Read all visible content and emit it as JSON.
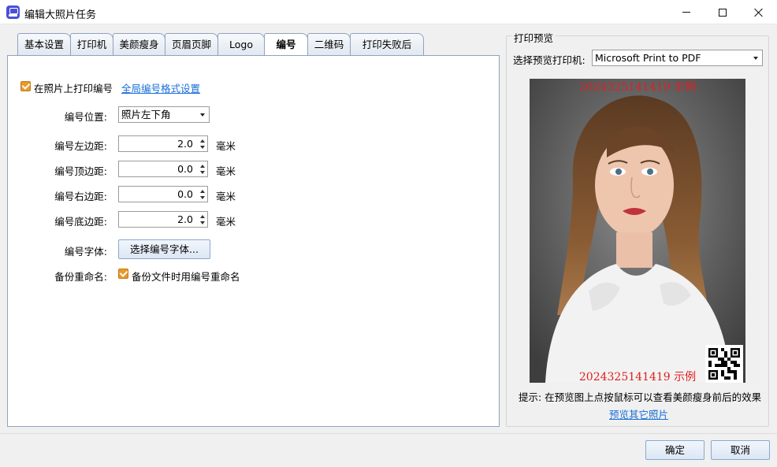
{
  "window": {
    "title": "编辑大照片任务"
  },
  "tabs": [
    {
      "label": "基本设置"
    },
    {
      "label": "打印机"
    },
    {
      "label": "美颜瘦身"
    },
    {
      "label": "页眉页脚"
    },
    {
      "label": "Logo"
    },
    {
      "label": "编号"
    },
    {
      "label": "二维码"
    },
    {
      "label": "打印失败后"
    }
  ],
  "active_tab": "编号",
  "numbering": {
    "print_number_label": "在照片上打印编号",
    "print_number_checked": true,
    "global_format_link": "全局编号格式设置",
    "position_label": "编号位置:",
    "position_value": "照片左下角",
    "left_margin_label": "编号左边距:",
    "left_margin_value": "2.0",
    "top_margin_label": "编号顶边距:",
    "top_margin_value": "0.0",
    "right_margin_label": "编号右边距:",
    "right_margin_value": "0.0",
    "bottom_margin_label": "编号底边距:",
    "bottom_margin_value": "2.0",
    "unit": "毫米",
    "font_label": "编号字体:",
    "font_button": "选择编号字体...",
    "backup_rename_label": "备份重命名:",
    "backup_rename_checkbox": "备份文件时用编号重命名",
    "backup_rename_checked": true
  },
  "preview": {
    "group_title": "打印预览",
    "printer_label": "选择预览打印机:",
    "printer_value": "Microsoft Print to PDF",
    "top_number": "2024325141419 示例",
    "bottom_number": "2024325141419 示例",
    "hint": "提示: 在预览图上点按鼠标可以查看美颜瘦身前后的效果",
    "other_photos_link": "预览其它照片"
  },
  "footer": {
    "ok": "确定",
    "cancel": "取消"
  },
  "colors": {
    "accent_checkbox": "#e89a2a",
    "link": "#1a6fd8",
    "number_red": "#e02020"
  }
}
